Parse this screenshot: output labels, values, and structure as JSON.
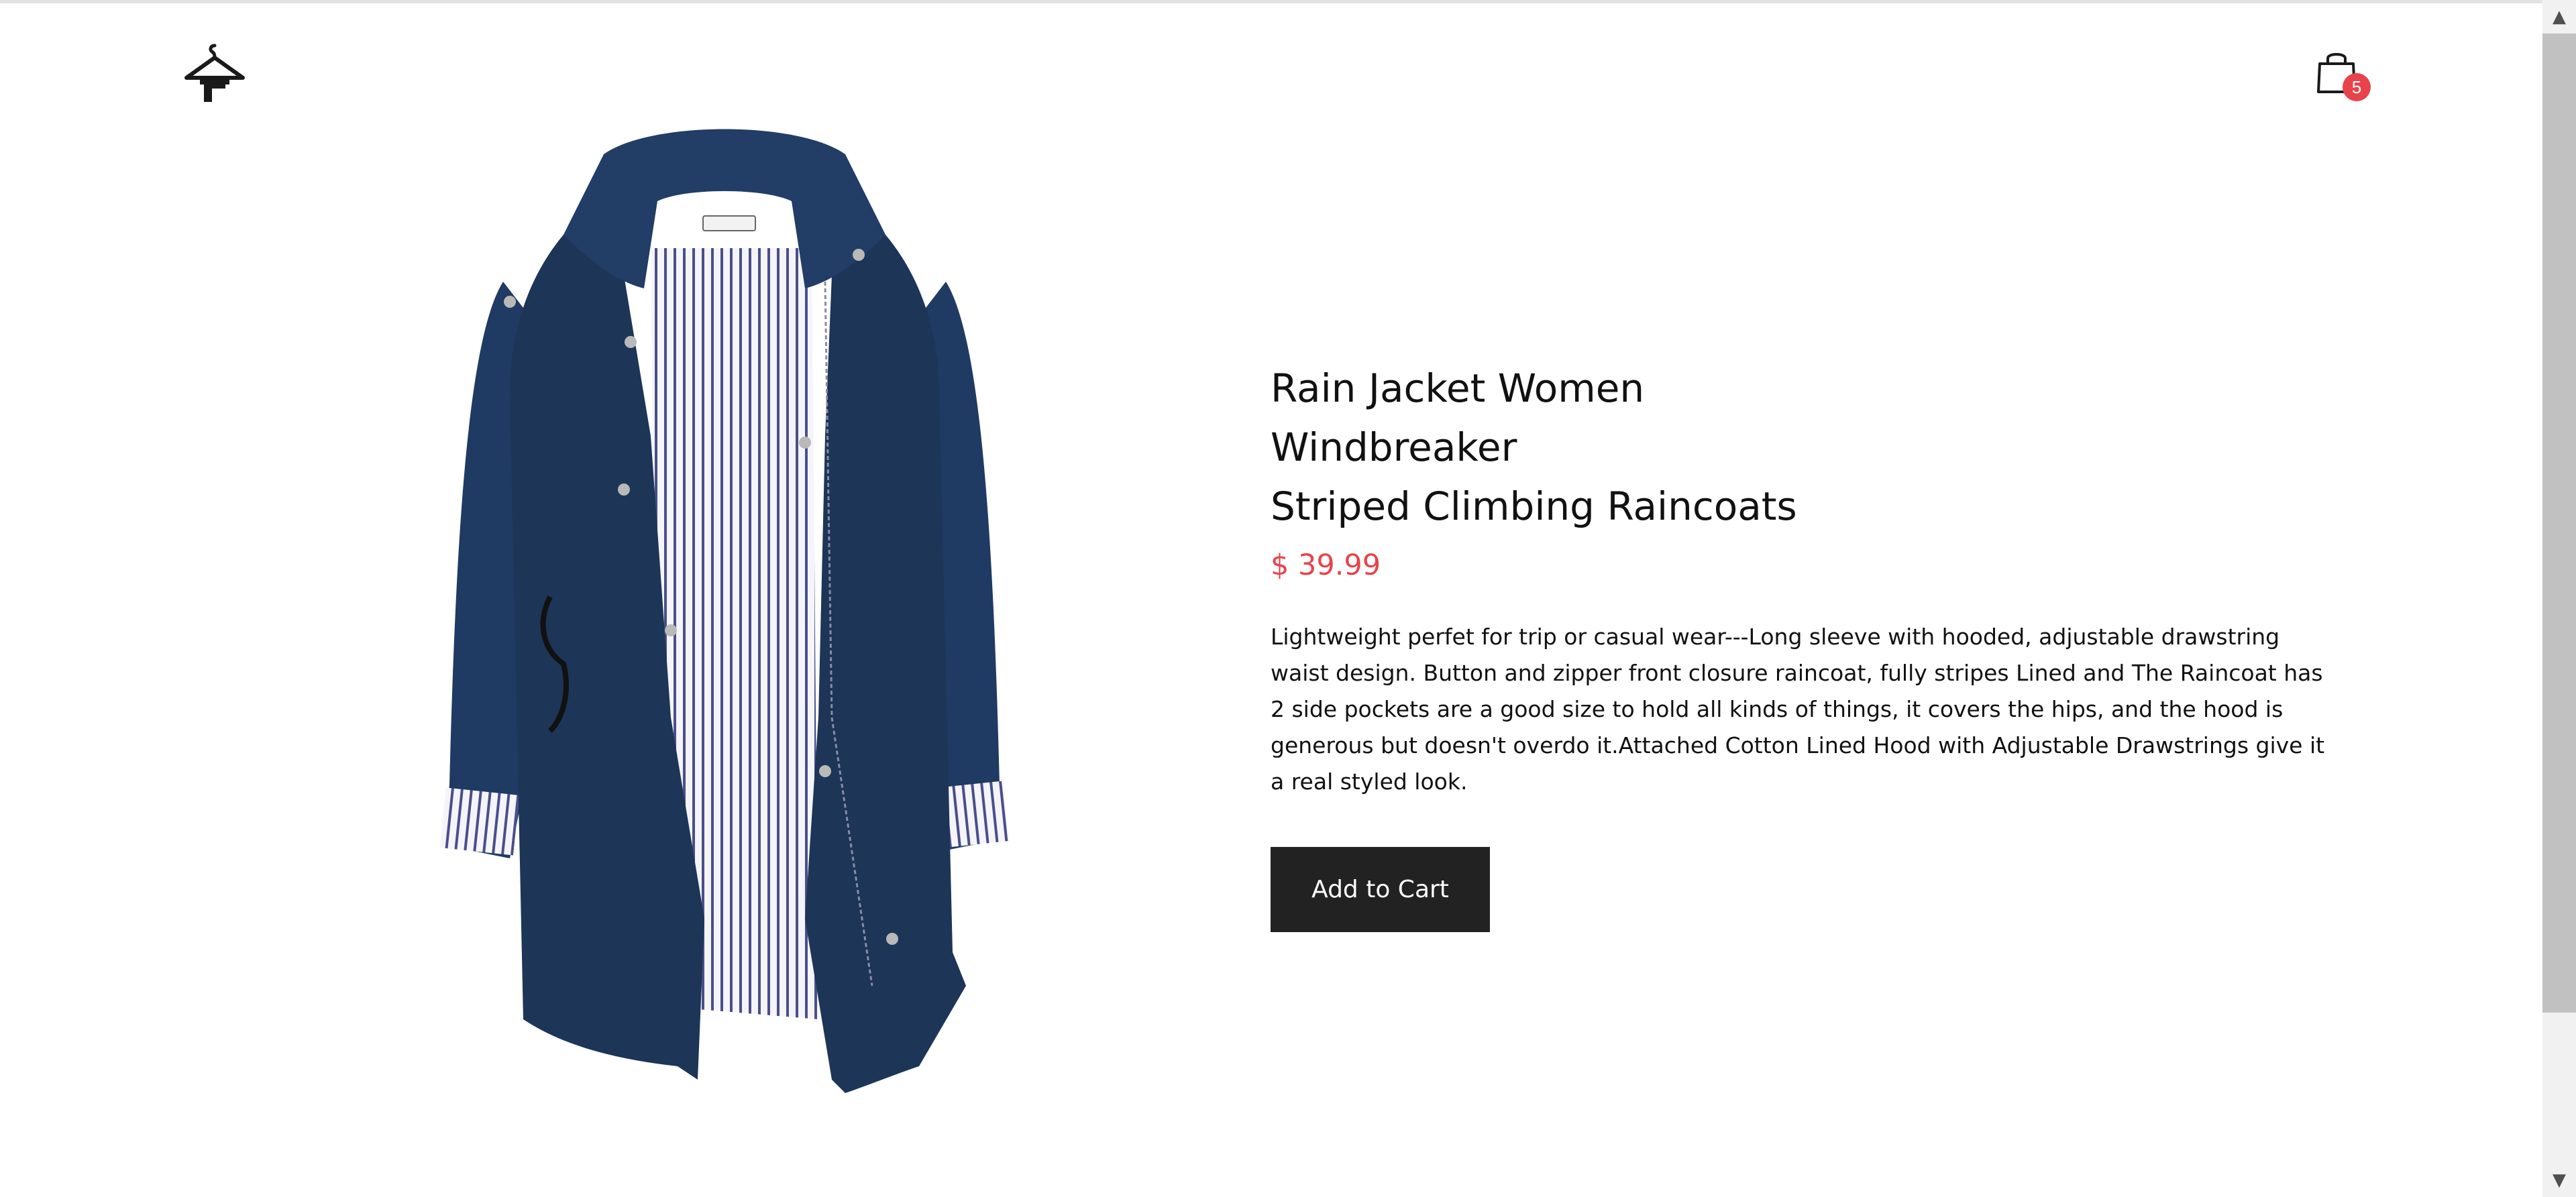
{
  "header": {
    "logo_icon": "hanger-house-icon",
    "cart_icon": "shopping-bag-icon",
    "cart_count": "5"
  },
  "product": {
    "image_subject": "navy rain jacket with striped lining",
    "title_line1": "Rain Jacket Women Windbreaker",
    "title_line2": "Striped Climbing Raincoats",
    "price": "$ 39.99",
    "description": "Lightweight perfet for trip or casual wear---Long sleeve with hooded, adjustable drawstring waist design. Button and zipper front closure raincoat, fully stripes Lined and The Raincoat has 2 side pockets are a good size to hold all kinds of things, it covers the hips, and the hood is generous but doesn't overdo it.Attached Cotton Lined Hood with Adjustable Drawstrings give it a real styled look.",
    "add_to_cart_label": "Add to Cart"
  },
  "colors": {
    "accent_red": "#e8434b",
    "button_dark": "#222222",
    "jacket_navy": "#1d3557"
  },
  "scrollbar": {
    "up_icon": "triangle-up-icon",
    "down_icon": "triangle-down-icon"
  }
}
